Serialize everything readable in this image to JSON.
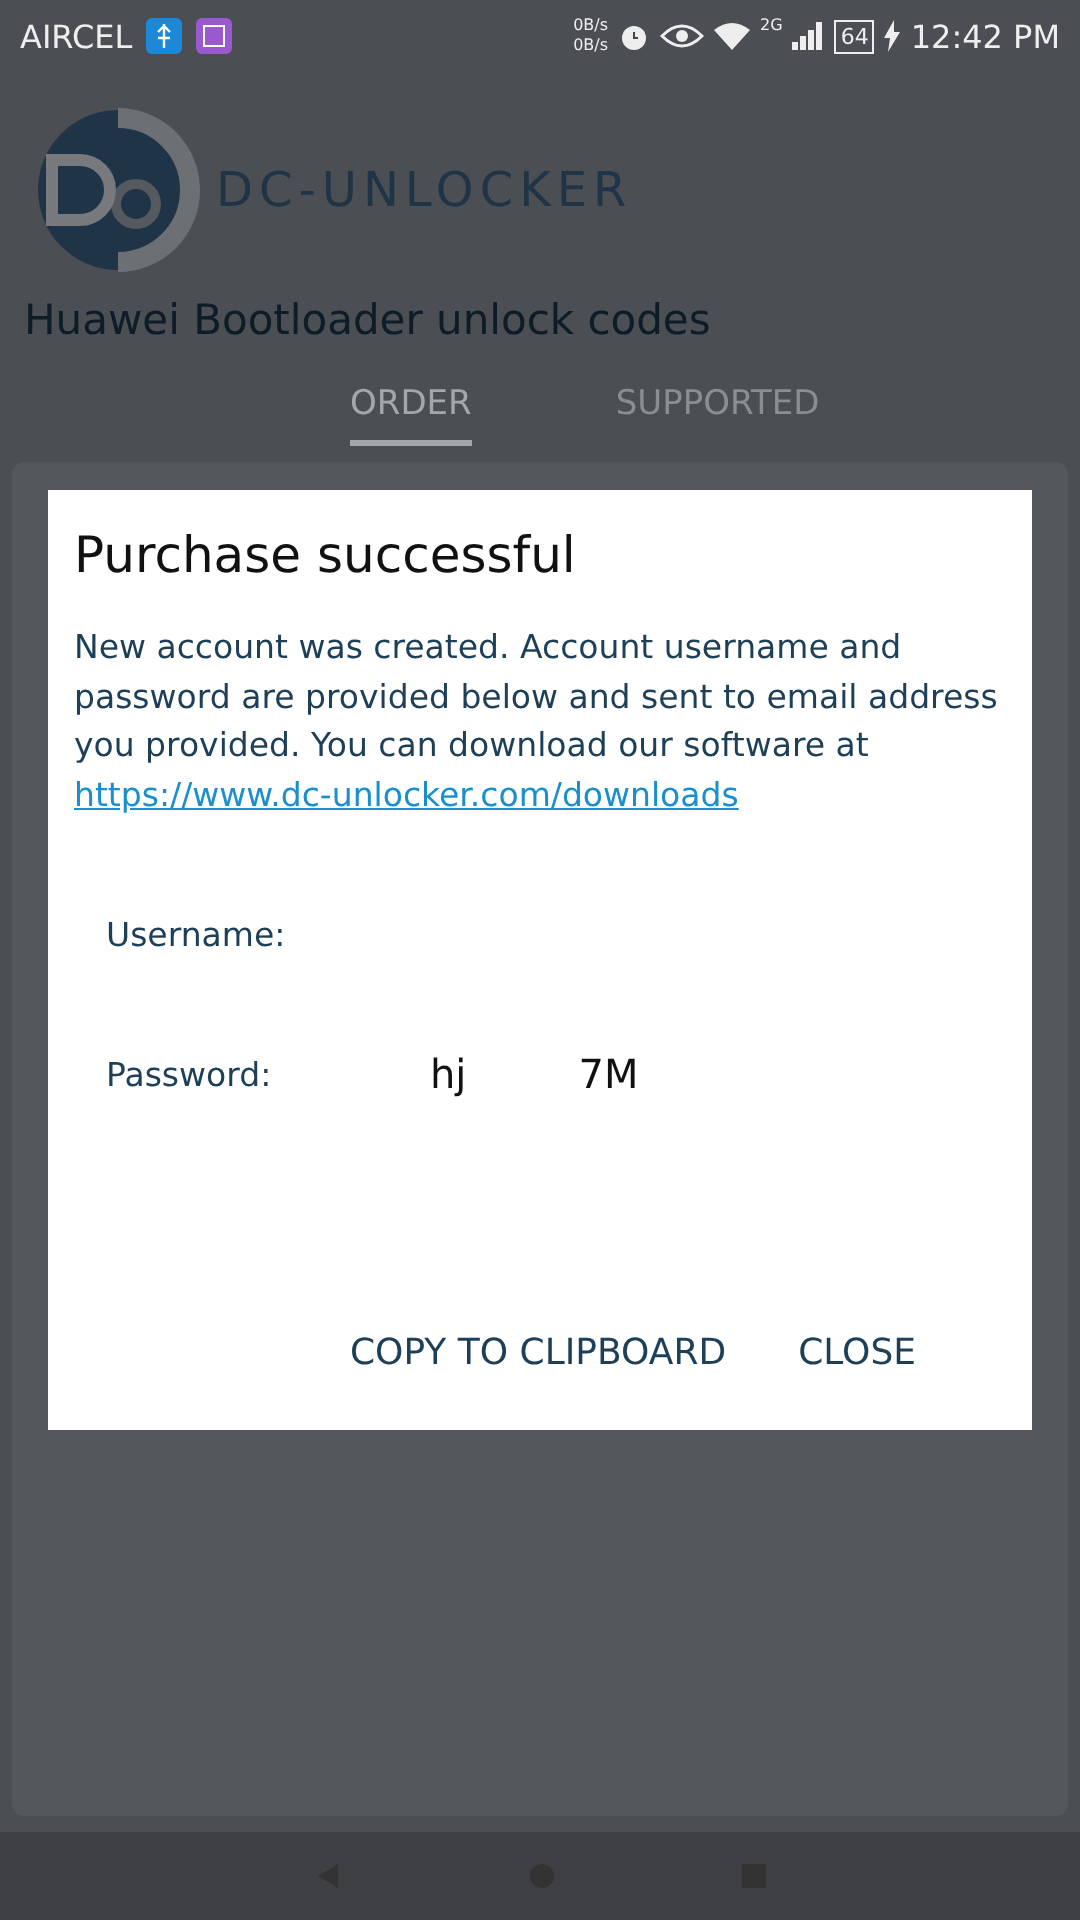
{
  "status_bar": {
    "carrier": "AIRCEL",
    "speed_up": "0B/s",
    "speed_down": "0B/s",
    "network": "2G",
    "battery": "64",
    "time": "12:42 PM"
  },
  "app": {
    "logo_text": "DC-UNLOCKER",
    "title": "Huawei Bootloader unlock codes",
    "tabs": [
      {
        "label": "ORDER",
        "selected": true
      },
      {
        "label": "SUPPORTED",
        "selected": false
      }
    ]
  },
  "dialog": {
    "title": "Purchase successful",
    "message": "New account was created. Account username and password are provided below and sent to email address you provided. You can download our software at ",
    "link": "https://www.dc-unlocker.com/downloads",
    "fields": [
      {
        "label": "Username:"
      },
      {
        "label": "Password:",
        "value_start": "hj",
        "value_end": "7M"
      }
    ],
    "buttons": [
      "COPY TO CLIPBOARD",
      "CLOSE"
    ]
  }
}
